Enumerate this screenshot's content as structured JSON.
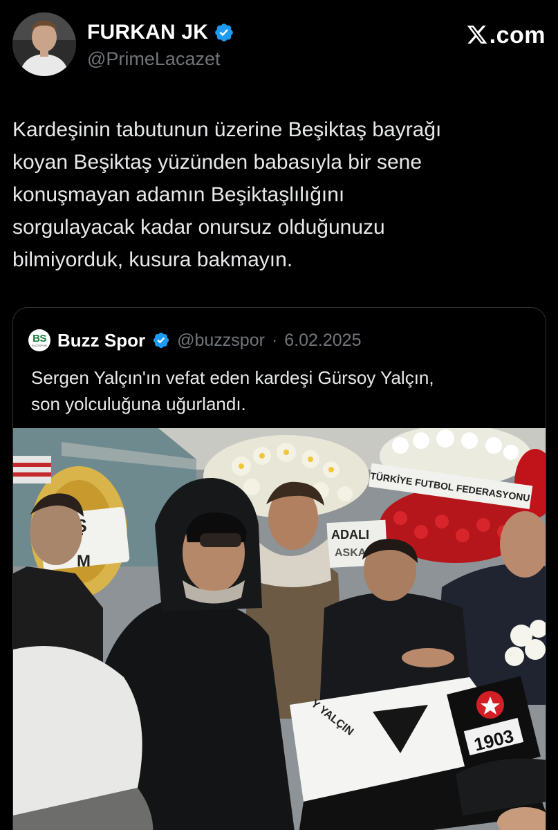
{
  "author": {
    "display_name": "FURKAN JK",
    "handle": "@PrimeLacazet",
    "verified": true
  },
  "brand": {
    "text": ".com",
    "logo_icon": "x-logo-icon"
  },
  "tweet": {
    "text": "Kardeşinin tabutunun üzerine Beşiktaş bayrağı\nkoyan Beşiktaş yüzünden babasıyla bir sene\nkonuşmayan adamın Beşiktaşlılığını\nsorgulayacak kadar onursuz olduğunuzu\nbilmiyorduk, kusura bakmayın."
  },
  "quote": {
    "logo_text": "BS",
    "logo_subtext": "BUZZSPOR",
    "display_name": "Buzz Spor",
    "verified": true,
    "handle": "@buzzspor",
    "separator": "·",
    "date": "6.02.2025",
    "text": "Sergen Yalçın'ın vefat eden kardeşi Gürsoy Yalçın,\nson yolculuğuna uğurlandı.",
    "media": {
      "banner_text": "TÜRKİYE FUTBOL FEDERASYONU",
      "left_sign_top": "EŞ",
      "left_sign_bottom": "M",
      "middle_sign_top": "ADALI",
      "middle_sign_bottom": "ASKA",
      "flag_text": "Y YALÇIN",
      "crest_year": "1903"
    }
  },
  "colors": {
    "background": "#000000",
    "text": "#e7e9ea",
    "muted": "#71767b",
    "verified": "#1d9bf0",
    "border": "#2f3336"
  }
}
